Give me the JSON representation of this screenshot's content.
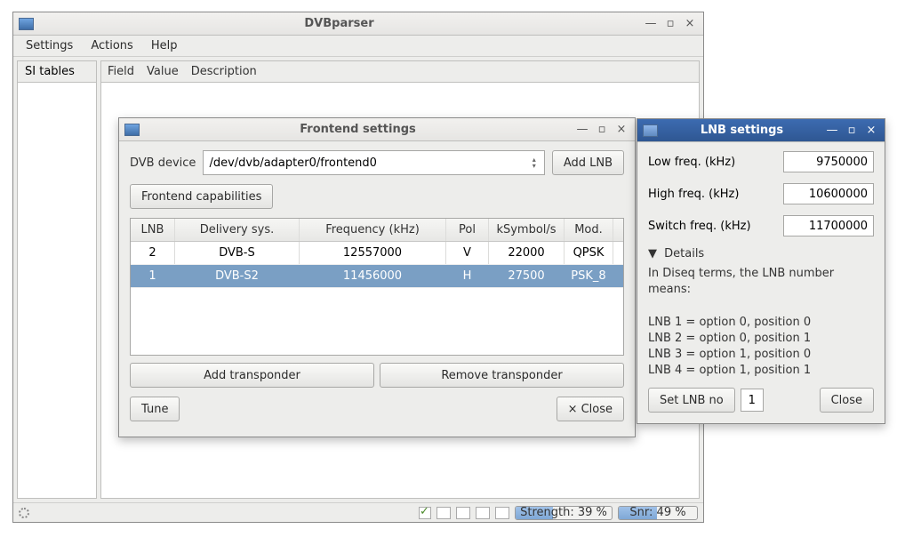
{
  "main": {
    "title": "DVBparser",
    "menu": {
      "settings": "Settings",
      "actions": "Actions",
      "help": "Help"
    },
    "left_tab": "SI tables",
    "right_cols": {
      "field": "Field",
      "value": "Value",
      "description": "Description"
    },
    "status": {
      "strength_label": "Strength: 39 %",
      "strength_pct": 39,
      "snr_label": "Snr: 49 %",
      "snr_pct": 49
    }
  },
  "frontend": {
    "title": "Frontend settings",
    "dvb_device_label": "DVB device",
    "dvb_device_value": "/dev/dvb/adapter0/frontend0",
    "add_lnb": "Add LNB",
    "frontend_caps": "Frontend capabilities",
    "cols": {
      "lnb": "LNB",
      "delivery": "Delivery sys.",
      "freq": "Frequency (kHz)",
      "pol": "Pol",
      "ksym": "kSymbol/s",
      "mod": "Mod."
    },
    "rows": [
      {
        "lnb": "2",
        "delivery": "DVB-S",
        "freq": "12557000",
        "pol": "V",
        "ksym": "22000",
        "mod": "QPSK",
        "selected": false
      },
      {
        "lnb": "1",
        "delivery": "DVB-S2",
        "freq": "11456000",
        "pol": "H",
        "ksym": "27500",
        "mod": "PSK_8",
        "selected": true
      }
    ],
    "add_tp": "Add transponder",
    "remove_tp": "Remove transponder",
    "tune": "Tune",
    "close": "Close"
  },
  "lnb": {
    "title": "LNB settings",
    "low_label": "Low freq. (kHz)",
    "low_value": "9750000",
    "high_label": "High freq. (kHz)",
    "high_value": "10600000",
    "switch_label": "Switch freq. (kHz)",
    "switch_value": "11700000",
    "details_label": "Details",
    "details_intro": "In Diseq terms, the LNB number means:",
    "details_l1": "LNB 1 = option 0, position 0",
    "details_l2": "LNB 2 = option 0, position 1",
    "details_l3": "LNB 3 = option 1, position 0",
    "details_l4": "LNB 4 = option 1, position 1",
    "set_lnb_no": "Set LNB no",
    "lnb_no_value": "1",
    "close": "Close"
  }
}
